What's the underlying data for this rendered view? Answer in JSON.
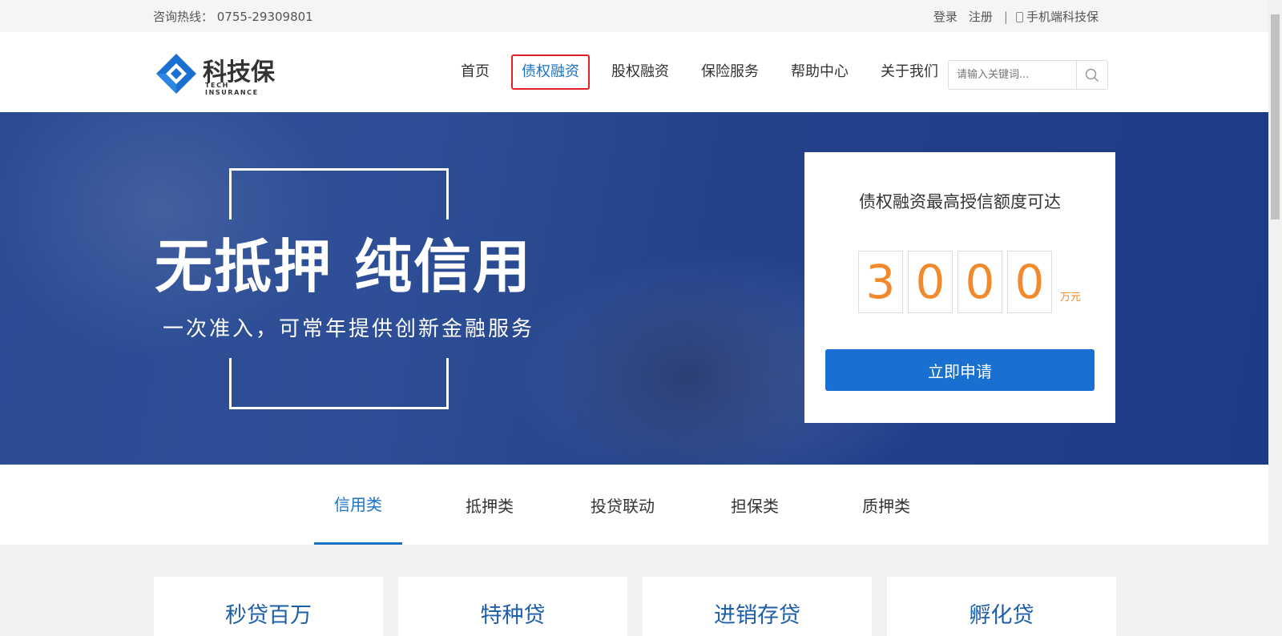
{
  "topbar": {
    "hotline": "咨询热线： 0755-29309801",
    "login": "登录",
    "register": "注册",
    "separator": "|",
    "mobile": "手机端科技保",
    "mobile_icon": "mobile-phone-icon"
  },
  "header": {
    "logo_name": "科技保",
    "logo_sub": "TECH INSURANCE",
    "logo_color": "#1a70d0",
    "nav": [
      {
        "label": "首页"
      },
      {
        "label": "债权融资"
      },
      {
        "label": "股权融资"
      },
      {
        "label": "保险服务"
      },
      {
        "label": "帮助中心"
      },
      {
        "label": "关于我们"
      }
    ],
    "active_nav": "债权融资",
    "search_placeholder": "请输入关键词...",
    "search_icon": "search-icon"
  },
  "banner": {
    "headline": "无抵押 纯信用",
    "subline": "一次准入，可常年提供创新金融服务",
    "card_title": "债权融资最高授信额度可达",
    "digits": [
      "3",
      "0",
      "0",
      "0"
    ],
    "unit": "万元",
    "apply_label": "立即申请",
    "accent_color": "#f08a2c",
    "button_color": "#1a70d0"
  },
  "tabs": [
    {
      "label": "信用类"
    },
    {
      "label": "抵押类"
    },
    {
      "label": "投贷联动"
    },
    {
      "label": "担保类"
    },
    {
      "label": "质押类"
    }
  ],
  "active_tab": "信用类",
  "products": [
    {
      "name": "秒贷百万"
    },
    {
      "name": "特种贷"
    },
    {
      "name": "进销存贷"
    },
    {
      "name": "孵化贷"
    }
  ]
}
